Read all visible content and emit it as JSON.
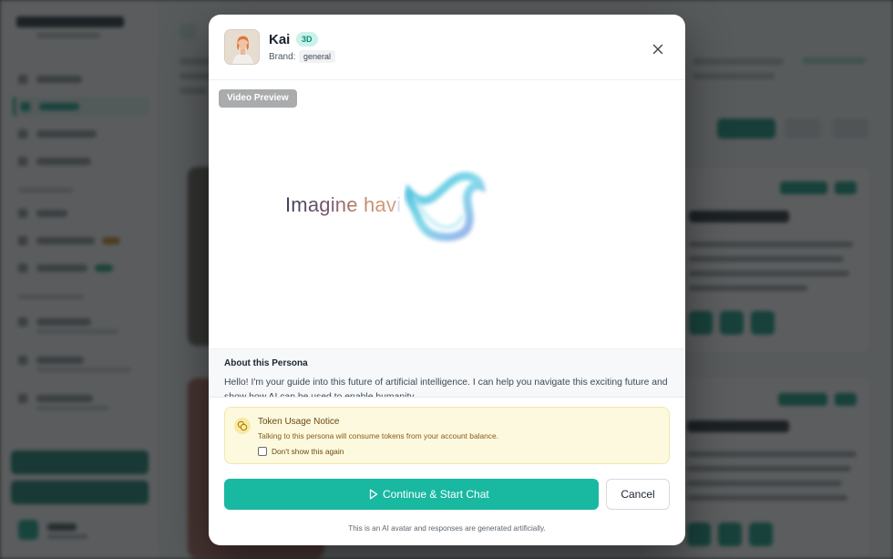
{
  "modal": {
    "persona_name": "Kai",
    "persona_type_badge": "3D",
    "brand_label": "Brand:",
    "brand_value": "general",
    "close_icon": "close-icon",
    "video": {
      "chip_label": "Video Preview",
      "caption_visible": "Imagine hav",
      "caption_faded": "i"
    },
    "about": {
      "title": "About this Persona",
      "text": "Hello! I'm your guide into this future of artificial intelligence. I can help you navigate this exciting future and show how AI can be used to enable humanity."
    },
    "notice": {
      "icon": "coins-icon",
      "title": "Token Usage Notice",
      "text": "Talking to this persona will consume tokens from your account balance.",
      "checkbox_label": "Don't show this again",
      "checkbox_checked": false
    },
    "primary_button": {
      "icon": "play-icon",
      "label": "Continue & Start Chat"
    },
    "cancel_button": {
      "label": "Cancel"
    },
    "disclaimer": "This is an AI avatar and responses are generated artificially."
  },
  "colors": {
    "accent": "#18b8a1",
    "badge_bg": "#c9f2ea",
    "notice_bg": "#fdf9df",
    "overlay": "#1c1e20"
  }
}
